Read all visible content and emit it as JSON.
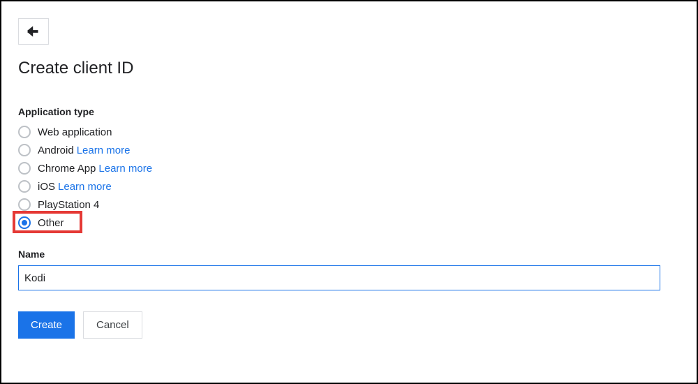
{
  "page": {
    "title": "Create client ID"
  },
  "form": {
    "app_type_label": "Application type",
    "radio_options": [
      {
        "label": "Web application",
        "learn_more": null,
        "selected": false
      },
      {
        "label": "Android",
        "learn_more": "Learn more",
        "selected": false
      },
      {
        "label": "Chrome App",
        "learn_more": "Learn more",
        "selected": false
      },
      {
        "label": "iOS",
        "learn_more": "Learn more",
        "selected": false
      },
      {
        "label": "PlayStation 4",
        "learn_more": null,
        "selected": false
      },
      {
        "label": "Other",
        "learn_more": null,
        "selected": true
      }
    ],
    "name_label": "Name",
    "name_value": "Kodi"
  },
  "buttons": {
    "create": "Create",
    "cancel": "Cancel"
  }
}
